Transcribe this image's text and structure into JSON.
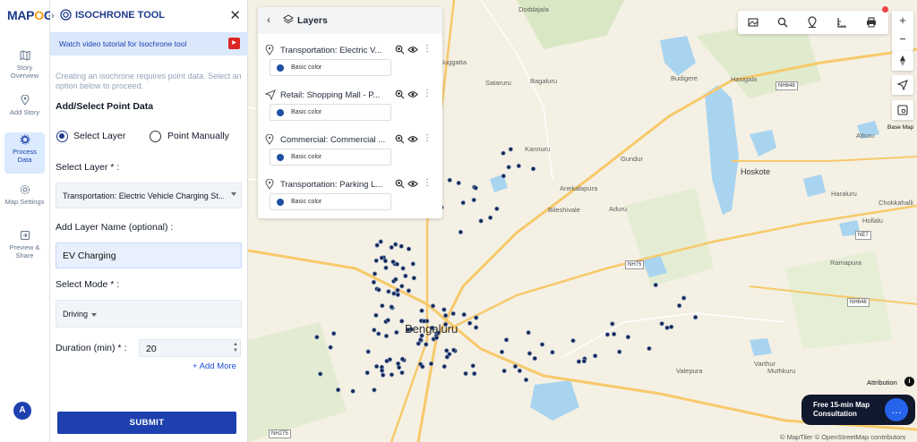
{
  "app": {
    "logo_prefix": "MAP",
    "logo_mid": "O",
    "logo_suffix": "G"
  },
  "rail": {
    "items": [
      {
        "icon": "map-icon",
        "label": "Story Overview"
      },
      {
        "icon": "location-pin-icon",
        "label": "Add Story"
      },
      {
        "icon": "gear-icon",
        "label": "Process Data"
      },
      {
        "icon": "settings-icon",
        "label": "Map Settings"
      },
      {
        "icon": "share-icon",
        "label": "Preview & Share"
      }
    ],
    "avatar_letter": "A"
  },
  "panel": {
    "title": "ISOCHRONE TOOL",
    "tutorial": "Watch video tutorial for Isochrone tool",
    "hint": "Creating an isochrone requires point data. Select an option below to proceed.",
    "section_title": "Add/Select Point Data",
    "radio_select_layer": "Select Layer",
    "radio_point_manually": "Point Manually",
    "select_layer_label": "Select Layer * :",
    "select_layer_value": "Transportation: Electric Vehicle Charging St...",
    "layer_name_label": "Add Layer Name (optional) :",
    "layer_name_value": "EV Charging",
    "mode_label": "Select Mode * :",
    "mode_value": "Driving",
    "duration_label": "Duration (min) * :",
    "duration_value": "20",
    "add_more": "+ Add More",
    "submit": "SUBMIT"
  },
  "layers_panel": {
    "title": "Layers",
    "items": [
      {
        "name": "Transportation: Electric V...",
        "color_label": "Basic color",
        "icon": "location-pin-icon"
      },
      {
        "name": "Retail: Shopping Mall - P...",
        "color_label": "Basic color",
        "icon": "map-pin-icon"
      },
      {
        "name": "Commercial: Commercial ...",
        "color_label": "Basic color",
        "icon": "location-pin-icon"
      },
      {
        "name": "Transportation: Parking L...",
        "color_label": "Basic color",
        "icon": "location-pin-icon"
      }
    ]
  },
  "map": {
    "city": "Bengaluru",
    "places": [
      "Doddajala",
      "Suggatta",
      "Sataruru",
      "Bagaluru",
      "Budigere",
      "Hasigala",
      "Kannuru",
      "Gundur",
      "Hoskote",
      "Anekalapura",
      "Aduru",
      "Bileshivale",
      "Atturu",
      "Haraluru",
      "Hollalu",
      "Chokkahalli",
      "Ramapura",
      "Varthur",
      "Valepura",
      "Muthkuru"
    ],
    "shields": [
      "NH648",
      "NE7",
      "NH75",
      "NH648",
      "NH275"
    ],
    "base_map_label": "Base Map",
    "attribution": "Attribution",
    "copyright": "© MapTiler © OpenStreetMap contributors",
    "consultation_line1": "Free 15-min Map",
    "consultation_line2": "Consultation"
  },
  "colors": {
    "primary": "#1e40af",
    "tutorial_bg": "#dbe8fb",
    "water": "#a8d4f0",
    "map_bg": "#f4f0e4",
    "point": "#0f2554"
  }
}
